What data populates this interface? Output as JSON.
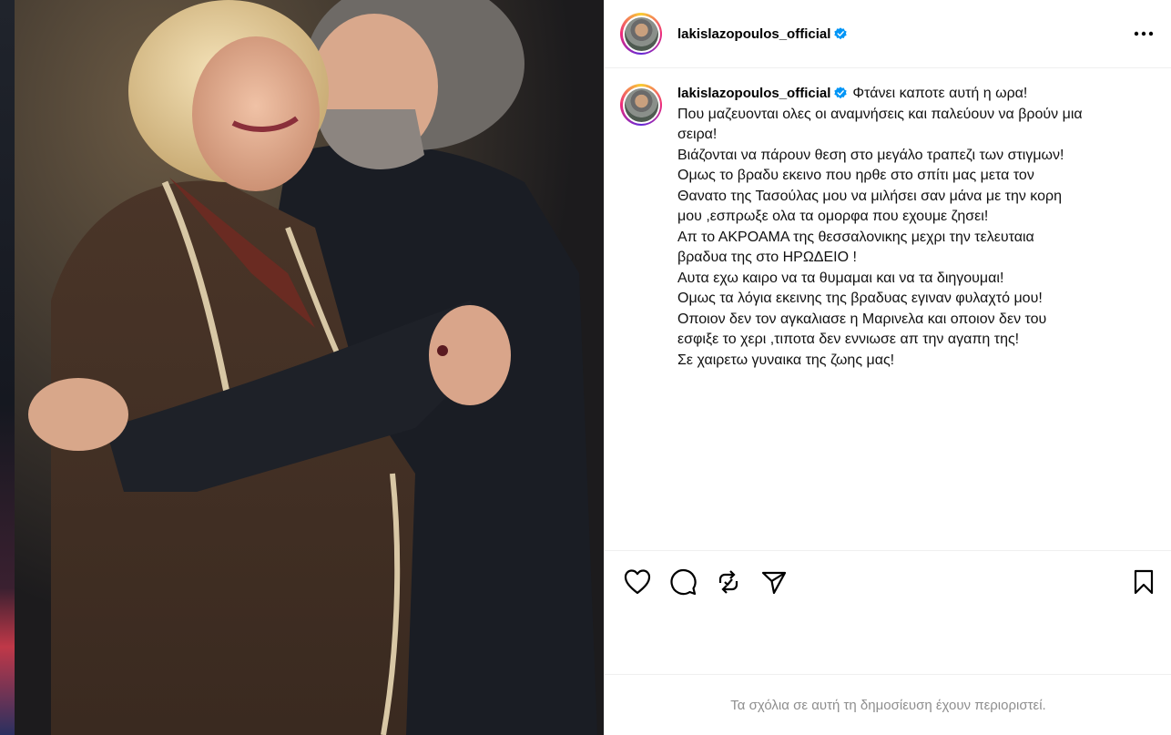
{
  "post": {
    "username": "lakislazopoulos_official",
    "photo_description_icon": "photo",
    "caption_lines": [
      "Φτάνει καποτε αυτή η ωρα!",
      "Που μαζευονται ολες οι αναμνήσεις και παλεύουν να βρούν μια",
      "σειρα!",
      "Βιάζονται να πάρουν θεση στο μεγάλο τραπεζι των στιγμων!",
      "Ομως το βραδυ εκεινο που ηρθε στο σπίτι μας μετα τον",
      "Θανατο της Τασούλας μου να μιλήσει σαν μάνα με την κορη",
      "μου ,εσπρωξε ολα τα ομορφα που εχουμε ζησει!",
      "Απ το ΑΚΡΟΑΜΑ της θεσσαλονικης μεχρι την τελευταια",
      "βραδυα της στο ΗΡΩΔΕΙΟ !",
      "Αυτα εχω καιρο να τα θυμαμαι και να τα διηγουμαι!",
      "Ομως τα λόγια εκεινης της βραδυας εγιναν φυλαχτό μου!",
      "Οποιον δεν τον αγκαλιασε η Μαρινελα και οποιον δεν του",
      "εσφιξε το χερι ,τιποτα δεν εννιωσε απ την αγαπη της!",
      "Σε χαιρετω γυναικα της ζωης μας!"
    ],
    "comments_disabled_text": "Τα σχόλια σε αυτή τη δημοσίευση έχουν περιοριστεί."
  },
  "colors": {
    "verified": "#0095f6",
    "muted": "#8e8e8e",
    "border": "#efefef"
  },
  "icons": {
    "more": "more-horizontal-icon",
    "like": "heart-icon",
    "comment": "comment-icon",
    "repost": "repost-icon",
    "share": "send-icon",
    "save": "bookmark-icon"
  }
}
